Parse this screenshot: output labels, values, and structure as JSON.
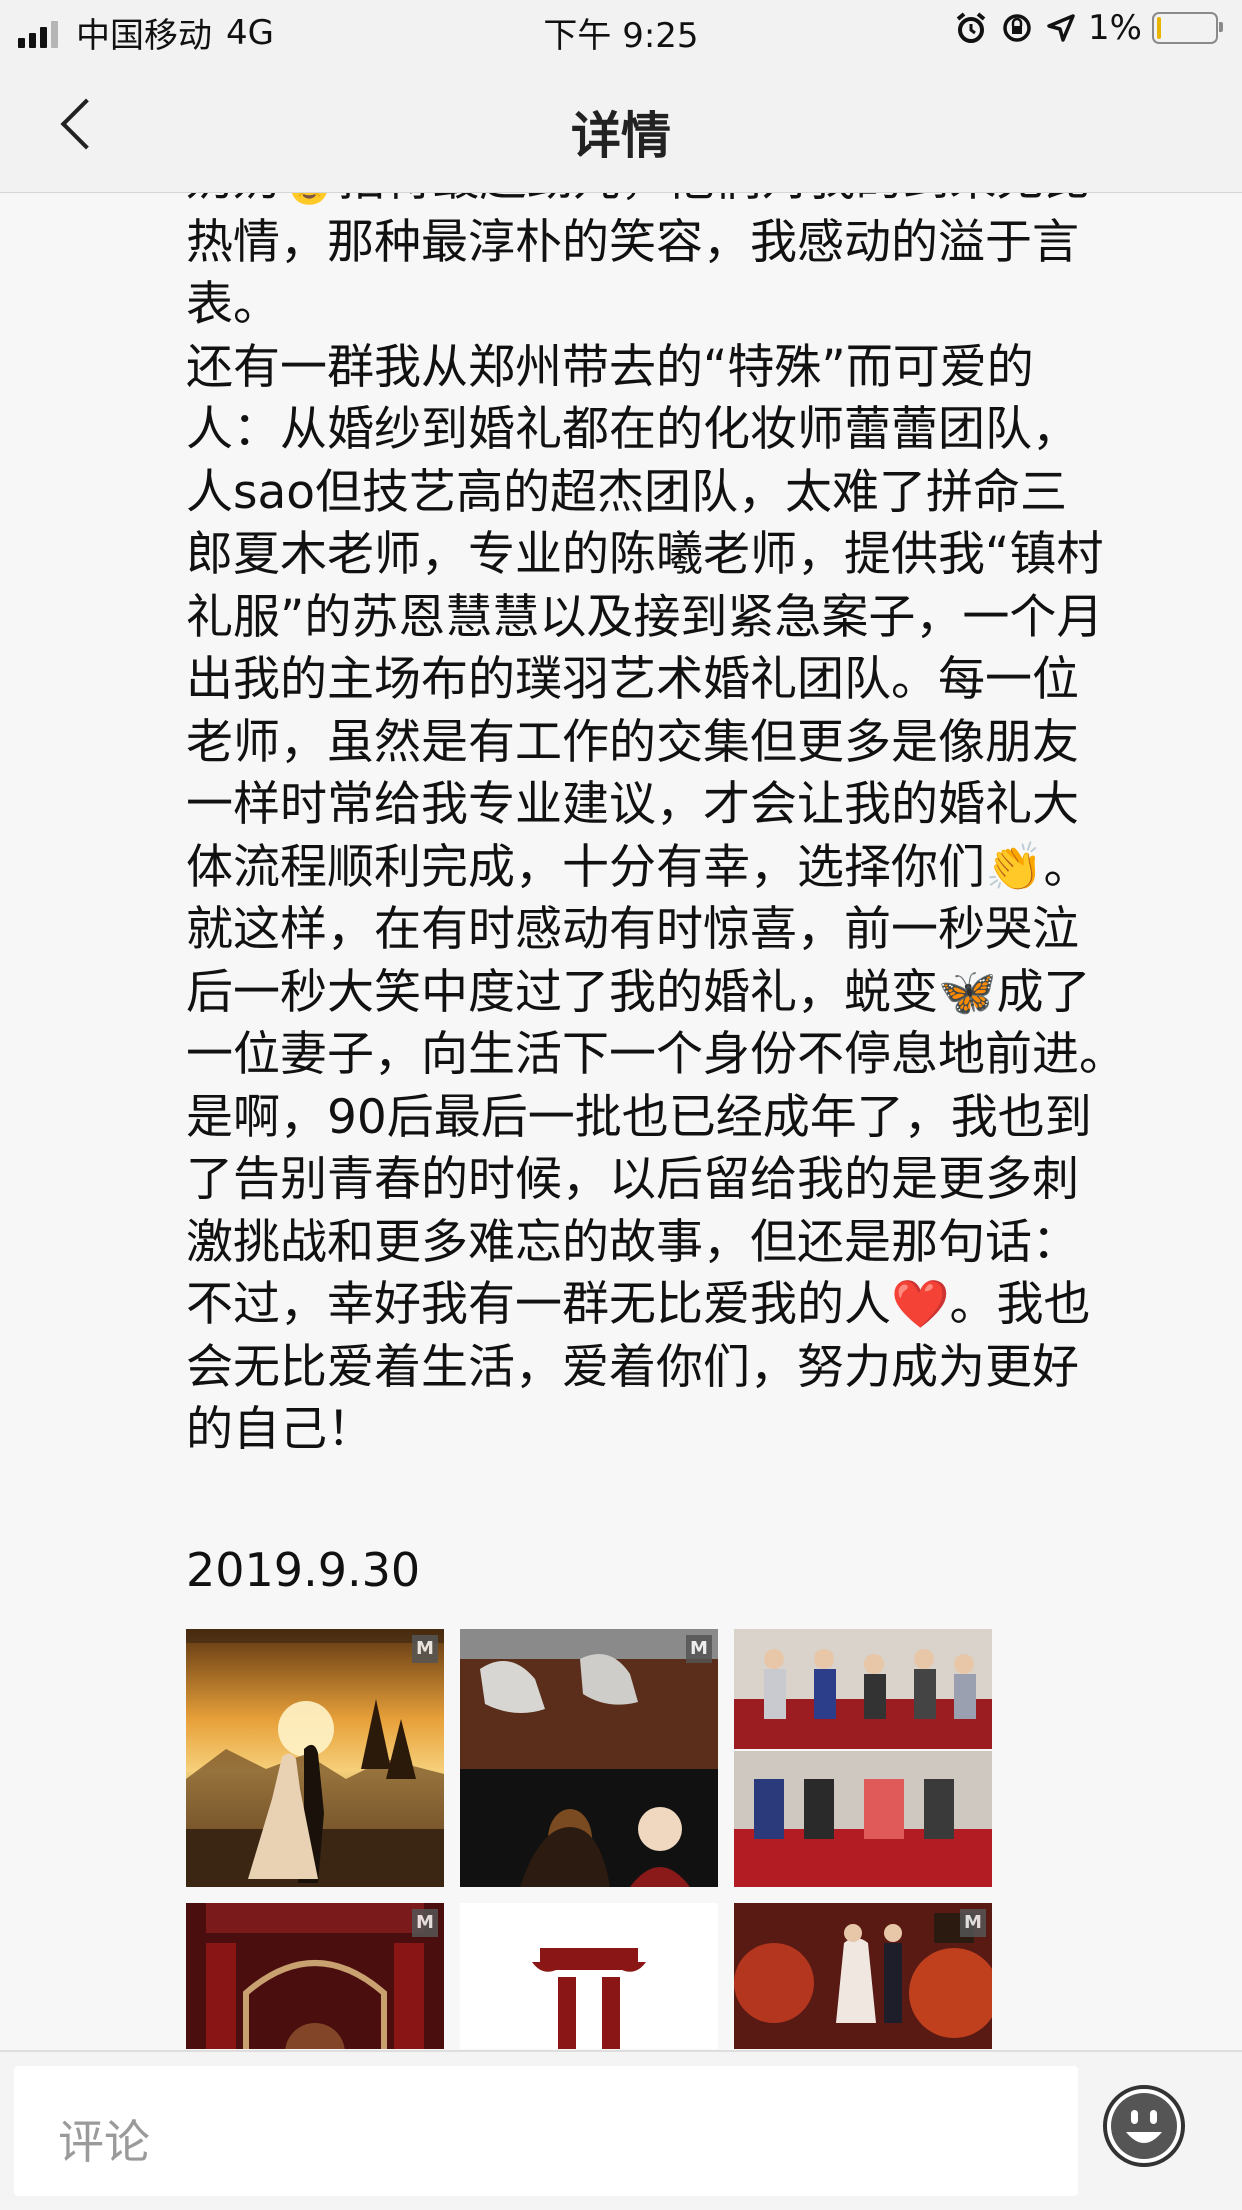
{
  "status_bar": {
    "carrier": "中国移动",
    "network": "4G",
    "time": "下午 9:25",
    "battery_percent": "1%",
    "battery_level": 0.01,
    "icons": [
      "alarm-icon",
      "rotation-lock-icon",
      "location-arrow-icon"
    ]
  },
  "nav": {
    "title": "详情",
    "back_icon": "chevron-left-icon"
  },
  "article": {
    "lines": [
      "奶奶👵招待最起劲儿，他们对我的到来无比",
      "热情，那种最淳朴的笑容，我感动的溢于言",
      "表。",
      "还有一群我从郑州带去的“特殊”而可爱的",
      "人：从婚纱到婚礼都在的化妆师蕾蕾团队，",
      "人sao但技艺高的超杰团队，太难了拼命三",
      "郎夏木老师，专业的陈曦老师，提供我“镇村",
      "礼服”的苏恩慧慧以及接到紧急案子，一个月",
      "出我的主场布的璞羽艺术婚礼团队。每一位",
      "老师，虽然是有工作的交集但更多是像朋友",
      "一样时常给我专业建议，才会让我的婚礼大",
      "体流程顺利完成，十分有幸，选择你们👏。",
      "就这样，在有时感动有时惊喜，前一秒哭泣",
      "后一秒大笑中度过了我的婚礼，蜕变🦋成了",
      "一位妻子，向生活下一个身份不停息地前进。",
      "是啊，90后最后一批也已经成年了，我也到",
      "了告别青春的时候，以后留给我的是更多刺",
      "激挑战和更多难忘的故事，但还是那句话：",
      "不过，幸好我有一群无比爱我的人❤️。我也",
      "会无比爱着生活，爱着你们，努力成为更好",
      "的自己！"
    ],
    "date": "2019.9.30"
  },
  "photos": [
    {
      "name": "sunset-couple-photo",
      "watermark": "M"
    },
    {
      "name": "wedding-shoes-bride-photo",
      "watermark": "M"
    },
    {
      "name": "family-ceremony-collage-photo",
      "watermark": ""
    },
    {
      "name": "red-stage-photo",
      "watermark": "M"
    },
    {
      "name": "pillar-logo-image",
      "watermark": ""
    },
    {
      "name": "banquet-hall-photo",
      "watermark": "M"
    }
  ],
  "bottom_bar": {
    "comment_placeholder": "评论",
    "emoji_icon": "smiley-face-icon"
  }
}
